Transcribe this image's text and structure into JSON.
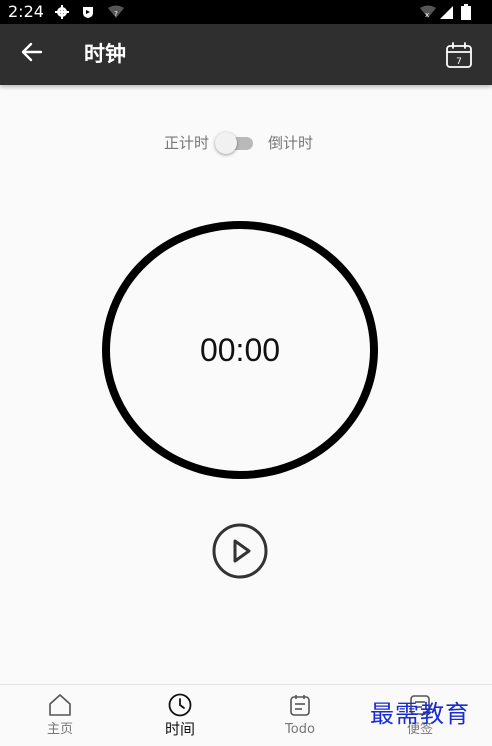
{
  "status_bar": {
    "time": "2:24",
    "icons": [
      "settings-icon",
      "shield-icon",
      "wifi-icon",
      "signal-icon",
      "battery-icon"
    ]
  },
  "app_bar": {
    "title": "时钟",
    "back_icon": "arrow-left-icon",
    "calendar_icon": "calendar-icon",
    "calendar_day": "7"
  },
  "timer": {
    "mode_left_label": "正计时",
    "mode_right_label": "倒计时",
    "mode_switch_on": false,
    "display": "00:00"
  },
  "bottom_nav": {
    "items": [
      {
        "label": "主页",
        "icon": "home-icon",
        "active": false
      },
      {
        "label": "时间",
        "icon": "clock-icon",
        "active": true
      },
      {
        "label": "Todo",
        "icon": "todo-list-icon",
        "active": false
      },
      {
        "label": "便签",
        "icon": "note-icon",
        "active": false
      }
    ]
  },
  "watermark": "最需教育",
  "colors": {
    "app_bar": "#2f2f2f",
    "status_bar": "#000000",
    "background": "#fafafa",
    "watermark": "#1a2ccf"
  }
}
